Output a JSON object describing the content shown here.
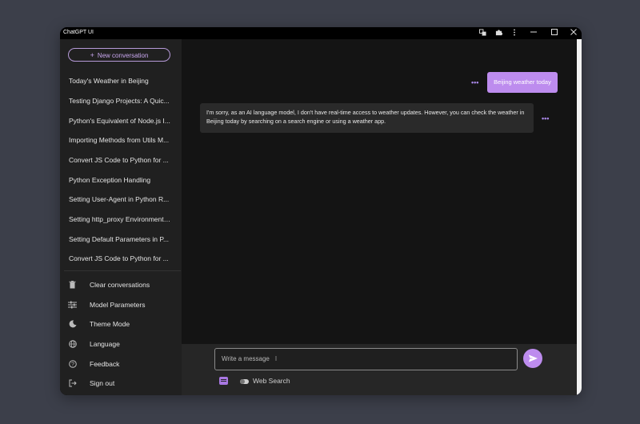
{
  "window": {
    "title": "ChatGPT UI",
    "controls": [
      "translate-icon",
      "extension-icon",
      "more-vert-icon",
      "minimize-icon",
      "maximize-icon",
      "close-icon"
    ]
  },
  "sidebar": {
    "new_conversation_label": "New conversation",
    "conversations": [
      "Today's Weather in Beijing",
      "Testing Django Projects: A Quic...",
      "Python's Equivalent of Node.js I...",
      "Importing Methods from Utils M...",
      "Convert JS Code to Python for ...",
      "Python Exception Handling",
      "Setting User-Agent in Python R...",
      "Setting http_proxy Environment ...",
      "Setting Default Parameters in P...",
      "Convert JS Code to Python for ..."
    ],
    "menu": [
      {
        "label": "Clear conversations",
        "icon": "trash-icon"
      },
      {
        "label": "Model Parameters",
        "icon": "sliders-icon"
      },
      {
        "label": "Theme Mode",
        "icon": "moon-icon"
      },
      {
        "label": "Language",
        "icon": "globe-icon"
      },
      {
        "label": "Feedback",
        "icon": "help-icon"
      },
      {
        "label": "Sign out",
        "icon": "logout-icon"
      }
    ]
  },
  "chat": {
    "messages": [
      {
        "role": "user",
        "text": "Beijing weather today"
      },
      {
        "role": "assistant",
        "text": "I'm sorry, as an AI language model, I don't have real-time access to weather updates. However, you can check the weather in Beijing today by searching on a search engine or using a weather app."
      }
    ]
  },
  "composer": {
    "placeholder": "Write a message",
    "web_search_label": "Web Search"
  },
  "colors": {
    "accent": "#bd8cee",
    "sidebar_bg": "#202020",
    "chat_bg": "#141414",
    "page_bg": "#3c3f4a"
  }
}
